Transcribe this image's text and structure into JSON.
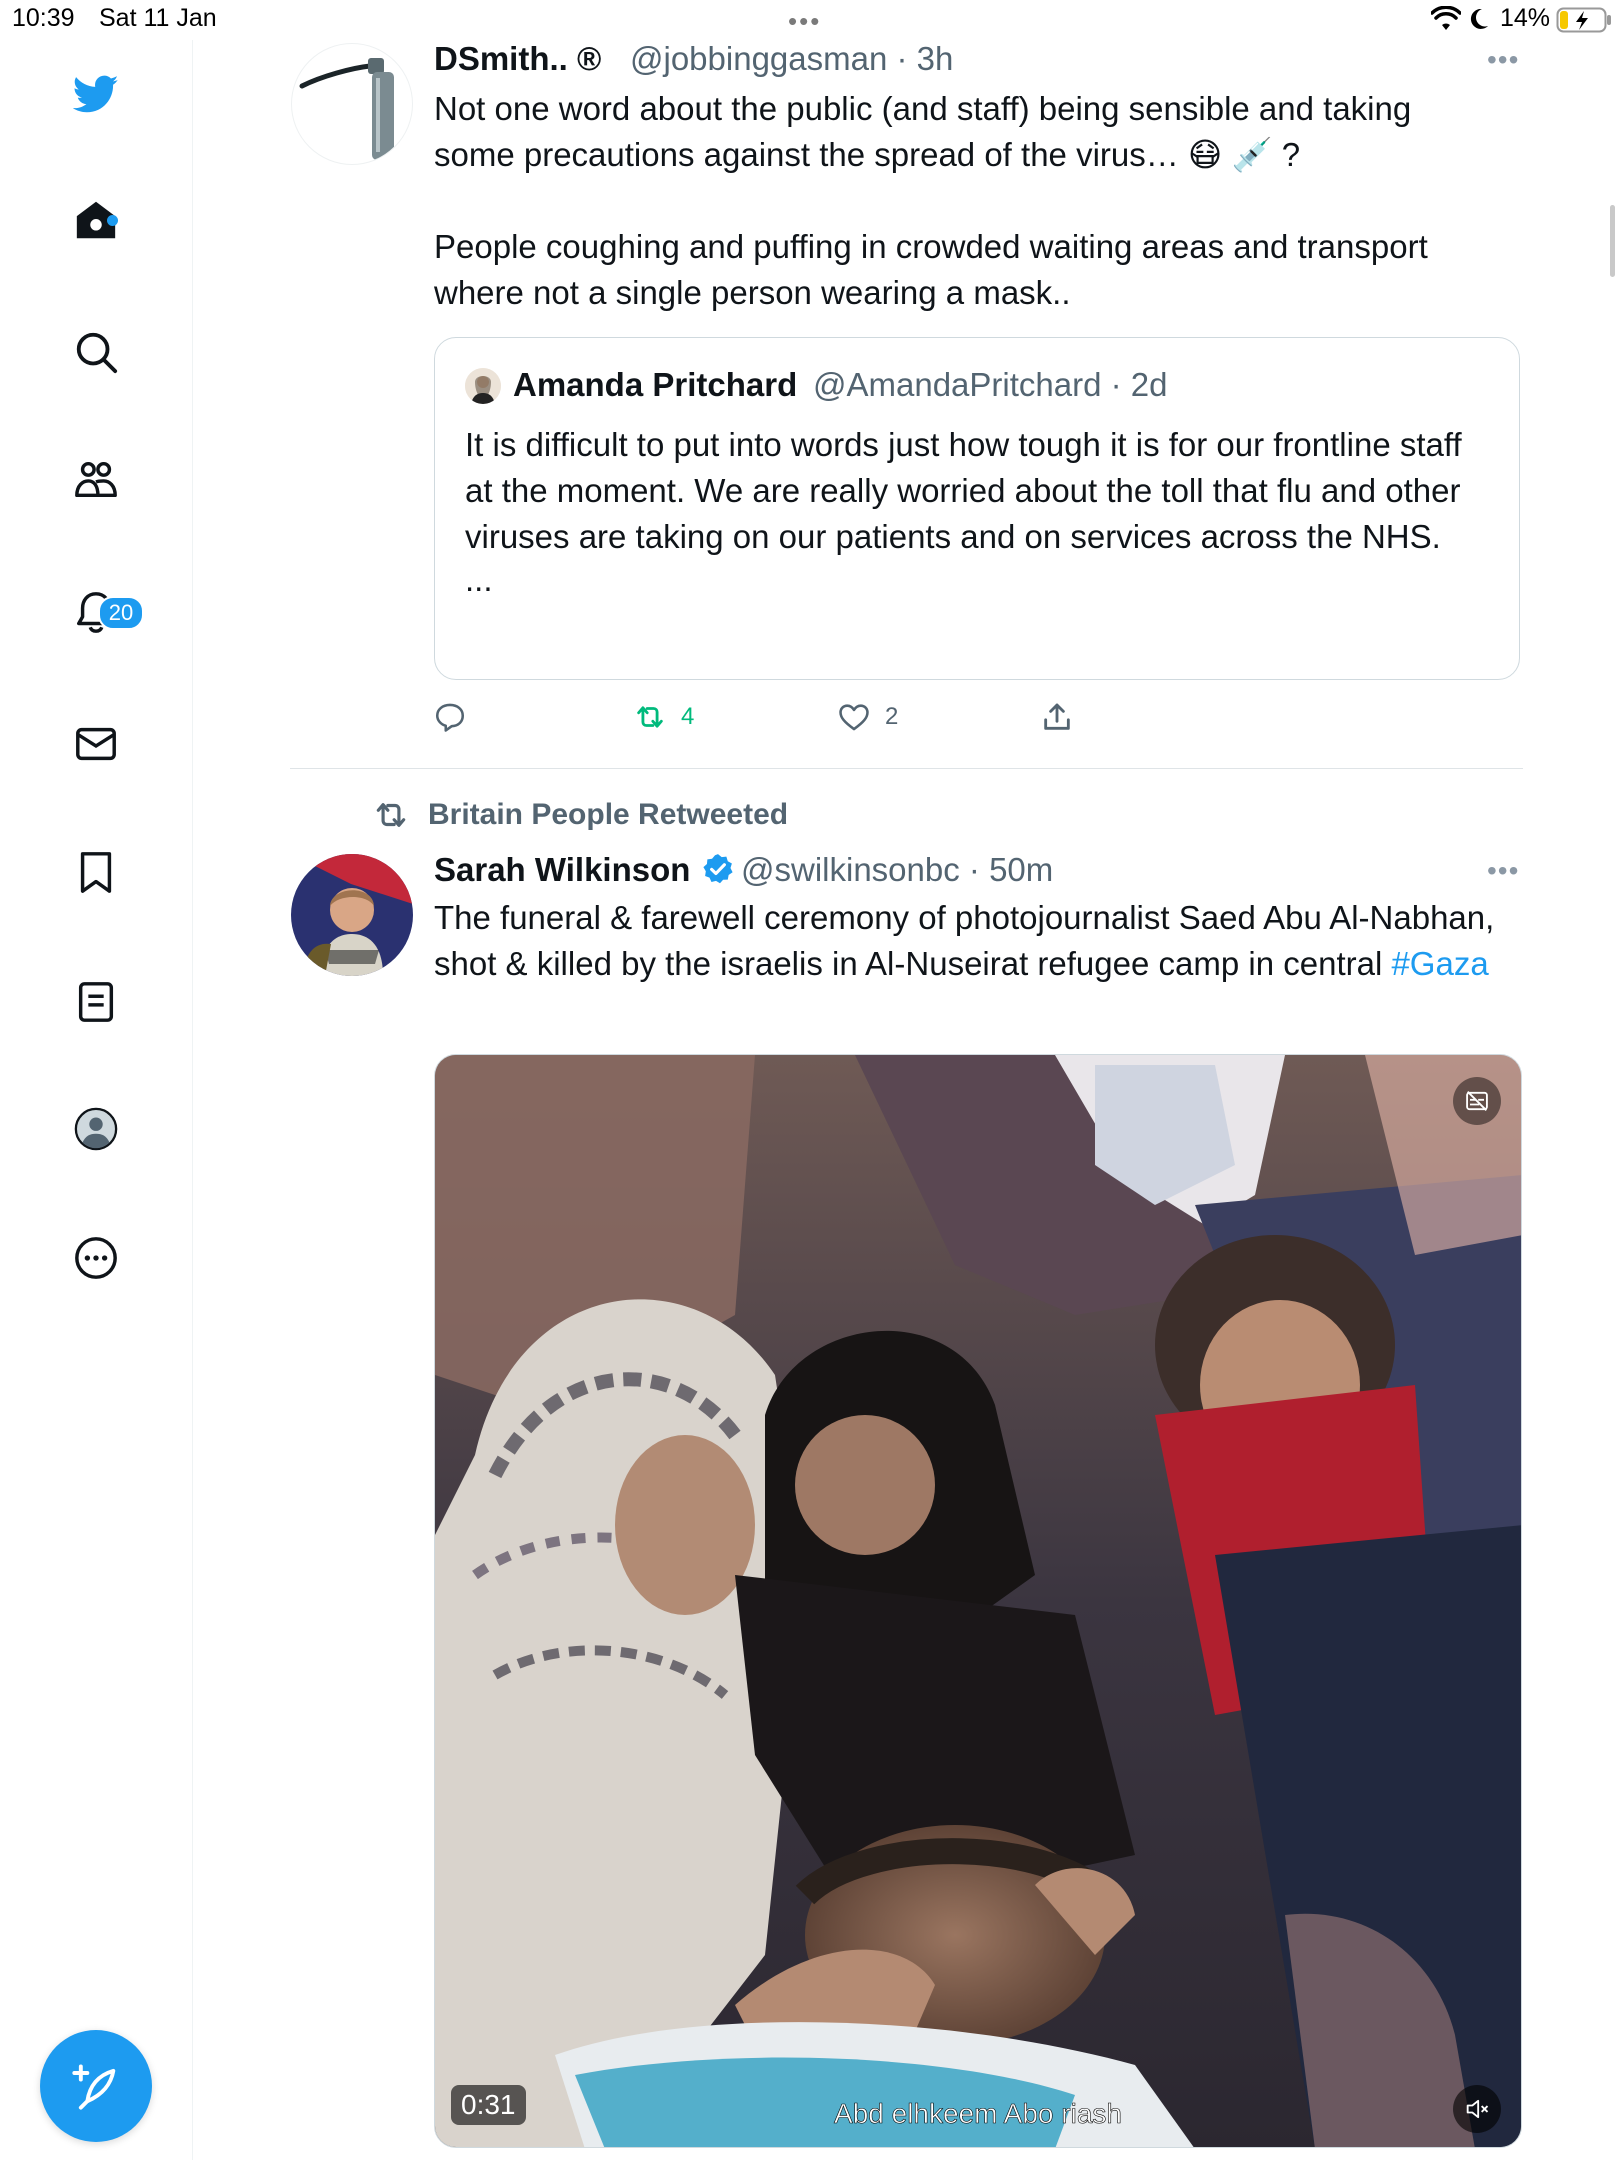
{
  "status_bar": {
    "time": "10:39",
    "date": "Sat 11 Jan",
    "battery": "14%"
  },
  "sidebar": {
    "items": [
      "twitter-logo",
      "home",
      "explore",
      "communities",
      "notifications",
      "messages",
      "bookmarks",
      "lists",
      "profile",
      "more"
    ],
    "notifications_badge": "20"
  },
  "tweet1": {
    "name": "DSmith.. ®",
    "handle": "@jobbinggasman",
    "time": "3h",
    "text_line1": "Not one word about the public (and staff) being sensible and taking",
    "text_line2": "some precautions against the spread of the virus… 😷 💉 ?",
    "text_para2": "People coughing and puffing in crowded waiting areas and transport where not a single person wearing a mask..",
    "quote": {
      "name": "Amanda Pritchard",
      "handle": "@AmandaPritchard",
      "time": "2d",
      "text": "It is difficult to put into words just how tough it is for our frontline staff at the moment. We are really worried about the toll that flu and other viruses are taking on our patients and on services across the NHS.",
      "ellipsis": "..."
    },
    "retweets": "4",
    "likes": "2"
  },
  "tweet2": {
    "retweeted_by": "Britain People Retweeted",
    "name": "Sarah Wilkinson",
    "handle": "@swilkinsonbc",
    "time": "50m",
    "text": "The funeral & farewell ceremony of photojournalist Saed Abu Al-Nabhan, shot & killed by the israelis in Al-Nuseirat refugee camp in central ",
    "hashtag": "#Gaza",
    "video": {
      "duration": "0:31",
      "subtitle": "Abd elhkeem Abo riash"
    }
  },
  "colors": {
    "accent": "#1d9bf0",
    "retweet_green": "#00ba7c",
    "secondary_text": "#536471"
  }
}
